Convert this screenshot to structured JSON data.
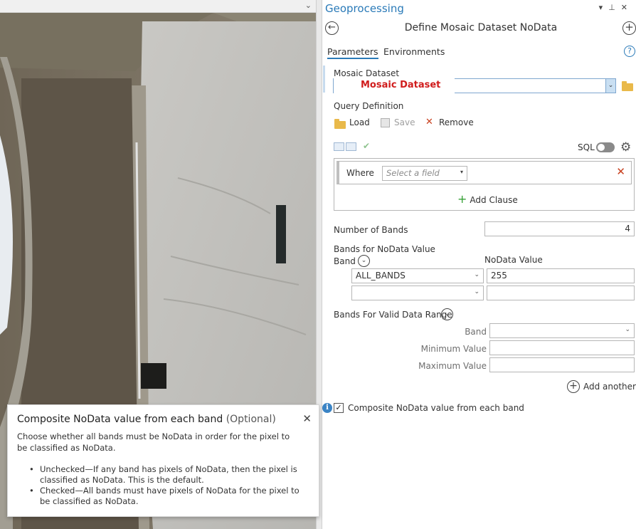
{
  "gp_title": "Geoprocessing",
  "tool_title": "Define Mosaic Dataset NoData",
  "tabs": [
    "Parameters",
    "Environments"
  ],
  "mosaic": {
    "label": "Mosaic Dataset",
    "value": "Mosaic Dataset"
  },
  "query": {
    "label": "Query Definition",
    "load": "Load",
    "save": "Save",
    "remove": "Remove",
    "sql_label": "SQL",
    "where_label": "Where",
    "where_placeholder": "Select a field",
    "add_clause": "Add Clause"
  },
  "num_bands": {
    "label": "Number of Bands",
    "value": "4"
  },
  "nodata": {
    "label": "Bands for NoData Value",
    "band_col": "Band",
    "value_col": "NoData Value",
    "rows": [
      {
        "band": "ALL_BANDS",
        "value": "255"
      },
      {
        "band": "",
        "value": ""
      }
    ]
  },
  "valid_range": {
    "label": "Bands For Valid Data Range",
    "band": "Band",
    "min": "Minimum Value",
    "max": "Maximum Value",
    "add_another": "Add another"
  },
  "composite": {
    "label": "Composite NoData value from each band",
    "checked": true
  },
  "tooltip": {
    "title": "Composite NoData value from each band",
    "optional": "(Optional)",
    "desc": "Choose whether all bands must be NoData in order for the pixel to be classified as NoData.",
    "bullets": [
      "Unchecked—If any band has pixels of NoData, then the pixel is classified as NoData. This is the default.",
      "Checked—All bands must have pixels of NoData for the pixel to be classified as NoData."
    ]
  },
  "icons": [
    "back-arrow-icon",
    "add-circle-icon",
    "help-icon",
    "folder-icon",
    "save-icon",
    "remove-x-icon",
    "gear-icon",
    "chevron-down-icon",
    "info-icon",
    "close-icon"
  ],
  "colors": {
    "accent": "#2a7ab8",
    "mosaic_label": "#d01c1c",
    "remove_x": "#c8401f",
    "add_green": "#35a035"
  }
}
